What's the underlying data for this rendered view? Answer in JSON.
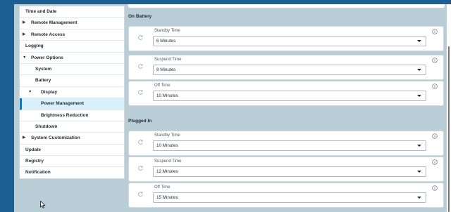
{
  "sidebar": {
    "items": [
      {
        "label": "Time and Date",
        "arrow": "",
        "level": 0
      },
      {
        "label": "Remote Management",
        "arrow": "▶",
        "level": 0
      },
      {
        "label": "Remote Access",
        "arrow": "▶",
        "level": 0
      },
      {
        "label": "Logging",
        "arrow": "",
        "level": 0
      },
      {
        "label": "Power Options",
        "arrow": "▼",
        "level": 0
      },
      {
        "label": "System",
        "arrow": "",
        "level": 1
      },
      {
        "label": "Battery",
        "arrow": "",
        "level": 1
      },
      {
        "label": "Display",
        "arrow": "▼",
        "level": 1
      },
      {
        "label": "Power Management",
        "arrow": "",
        "level": 2,
        "active": true
      },
      {
        "label": "Brightness Reduction",
        "arrow": "",
        "level": 2
      },
      {
        "label": "Shutdown",
        "arrow": "",
        "level": 1
      },
      {
        "label": "System Customization",
        "arrow": "▶",
        "level": 0
      },
      {
        "label": "Update",
        "arrow": "",
        "level": 0
      },
      {
        "label": "Registry",
        "arrow": "",
        "level": 0
      },
      {
        "label": "Notification",
        "arrow": "",
        "level": 0
      }
    ]
  },
  "main": {
    "on_battery": {
      "title": "On Battery",
      "settings": [
        {
          "label": "Standby Time",
          "value": "6 Minutes"
        },
        {
          "label": "Suspend Time",
          "value": "8 Minutes"
        },
        {
          "label": "Off Time",
          "value": "10 Minutes"
        }
      ]
    },
    "plugged_in": {
      "title": "Plugged In",
      "settings": [
        {
          "label": "Standby Time",
          "value": "10 Minutes"
        },
        {
          "label": "Suspend Time",
          "value": "12 Minutes"
        },
        {
          "label": "Off Time",
          "value": "15 Minutes"
        }
      ]
    }
  },
  "colors": {
    "accent": "#1c5f92",
    "background": "#b9cdd6",
    "active_item": "#d8f0fa",
    "active_border": "#1c74b8"
  },
  "icons": {
    "reset": "reset-icon",
    "info": "info-icon",
    "dropdown": "chevron-down-icon",
    "cursor": "mouse-pointer-icon"
  }
}
